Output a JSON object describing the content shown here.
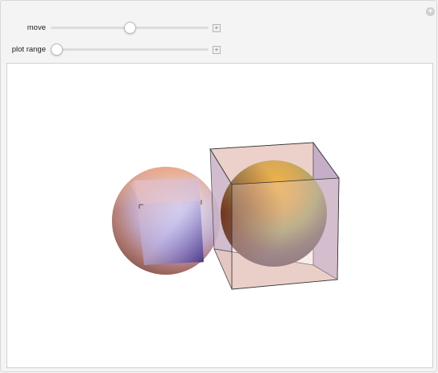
{
  "controls": {
    "move": {
      "label": "move",
      "value_fraction": 0.5
    },
    "plot_range": {
      "label": "plot range",
      "value_fraction": 0.0
    }
  },
  "icons": {
    "options": "plus-circle-icon",
    "increment": "plus-square-icon"
  },
  "colors": {
    "background": "#f4f4f4",
    "viewport": "#ffffff",
    "cube_fill": "#e8c9c0",
    "cube_edge": "#333333",
    "sphere_orange": "#e8a33a",
    "sphere_purple": "#6b4aa8"
  }
}
